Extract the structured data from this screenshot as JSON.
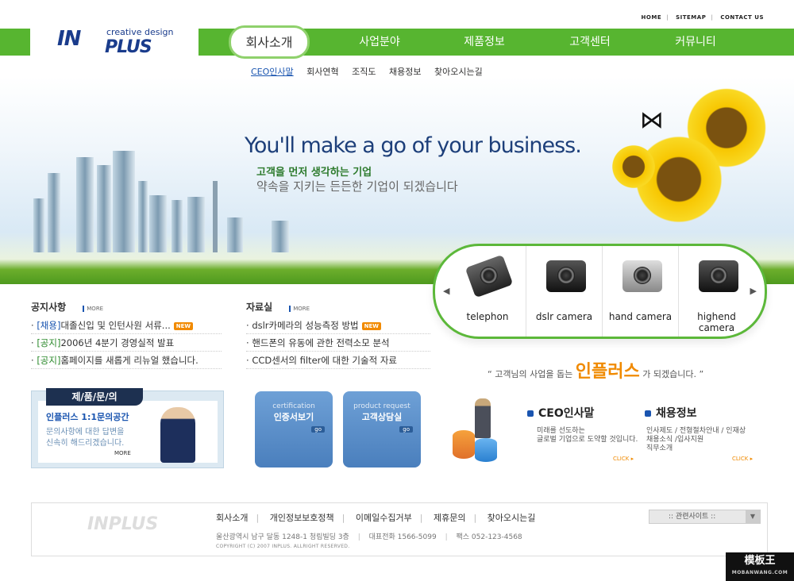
{
  "util_links": [
    "HOME",
    "SITEMAP",
    "CONTACT US"
  ],
  "logo": {
    "main": "IN",
    "sub": "creative design",
    "word": "PLUS"
  },
  "nav": [
    "회사소개",
    "사업분야",
    "제품정보",
    "고객센터",
    "커뮤니티"
  ],
  "subnav": [
    "CEO인사말",
    "회사연혁",
    "조직도",
    "채용정보",
    "찾아오시는길"
  ],
  "hero": {
    "headline": "You'll make a go of your business.",
    "tag1": "고객을 먼저 생각하는 기업",
    "tag2": "약속을 지키는 든든한 기업이 되겠습니다"
  },
  "products": [
    {
      "label": "telephon"
    },
    {
      "label": "dslr camera"
    },
    {
      "label": "hand camera"
    },
    {
      "label": "highend camera"
    }
  ],
  "notice": {
    "title": "공지사항",
    "more": "MORE",
    "items": [
      {
        "tag": "[채용]",
        "text": "대졸신입 및 인턴사원 서류...",
        "new": "NEW"
      },
      {
        "tag": "[공지]",
        "text": "2006년 4분기 경영실적 발표",
        "new": ""
      },
      {
        "tag": "[공지]",
        "text": "홈페이지를 새롭게 리뉴얼 했습니다.",
        "new": ""
      }
    ]
  },
  "data_room": {
    "title": "자료실",
    "more": "MORE",
    "items": [
      {
        "text": "dslr카메라의 성능측정 방법",
        "new": "NEW"
      },
      {
        "text": "핸드폰의 유동에 관한 전력소모 분석",
        "new": ""
      },
      {
        "text": "CCD센서의 filter에 대한 기술적 자료",
        "new": ""
      }
    ]
  },
  "quote": {
    "pre": "“ 고객님의 사업을 돕는 ",
    "brand": "인플러스",
    "post": " 가 되겠습니다. ”"
  },
  "inquiry": {
    "tab": "제/품/문/의",
    "title": "인플러스 1:1문의공간",
    "desc1": "문의사항에 대한 답변을",
    "desc2": "신속히 해드리겠습니다.",
    "more": "MORE"
  },
  "btns": [
    {
      "en": "certification",
      "ko": "인증서보기",
      "go": "go"
    },
    {
      "en": "product request",
      "ko": "고객상담실",
      "go": "go"
    }
  ],
  "ceo": {
    "title": "CEO인사말",
    "desc1": "미래를 선도하는",
    "desc2": "글로벌 기업으로 도약할 것입니다.",
    "click": "CLICK"
  },
  "recruit": {
    "title": "채용정보",
    "desc1": "인사제도 / 전형절차안내 / 인재상",
    "desc2": "채용소식 /입사지원",
    "desc3": "직무소개",
    "click": "CLICK"
  },
  "footer": {
    "links": [
      "회사소개",
      "개인정보보호정책",
      "이메일수집거부",
      "제휴문의",
      "찾아오시는길"
    ],
    "address": "울산광역시 남구 달동 1248-1 청림빌딩 3층",
    "tel": "대표전화  1566-5099",
    "fax": "팩스  052-123-4568",
    "copyright": "COPYRIGHT (C) 2007 INPLUS. ALLRIGHT RESERVED.",
    "related": ":: 관련사이트 ::"
  },
  "watermark": {
    "main": "模板王",
    "sub": "MOBANWANG.COM"
  }
}
